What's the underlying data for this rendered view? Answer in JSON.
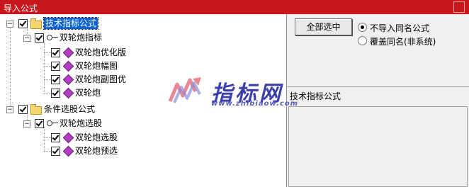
{
  "window": {
    "title": "导入公式"
  },
  "tree": {
    "groups": [
      {
        "label": "技术指标公式",
        "selected": true,
        "children": [
          {
            "label": "双轮炮指标",
            "items": [
              "双轮炮优化版",
              "双轮炮幅图",
              "双轮炮副图优",
              "双轮炮"
            ]
          }
        ]
      },
      {
        "label": "条件选股公式",
        "selected": false,
        "children": [
          {
            "label": "双轮炮选股",
            "items": [
              "双轮炮选股",
              "双轮炮预选"
            ]
          }
        ]
      }
    ]
  },
  "panel": {
    "select_all_label": "全部选中",
    "radio_options": [
      {
        "label": "不导入同名公式",
        "checked": true
      },
      {
        "label": "覆盖同名(非系统)",
        "checked": false
      }
    ],
    "formula_type": "技术指标公式",
    "description": ""
  },
  "watermark": {
    "brand": "指标网",
    "url": "www.zhibiaow.com"
  },
  "colors": {
    "titlebar": "#c8161d",
    "selection": "#0a64d7",
    "watermark": "#3b3fa8"
  }
}
